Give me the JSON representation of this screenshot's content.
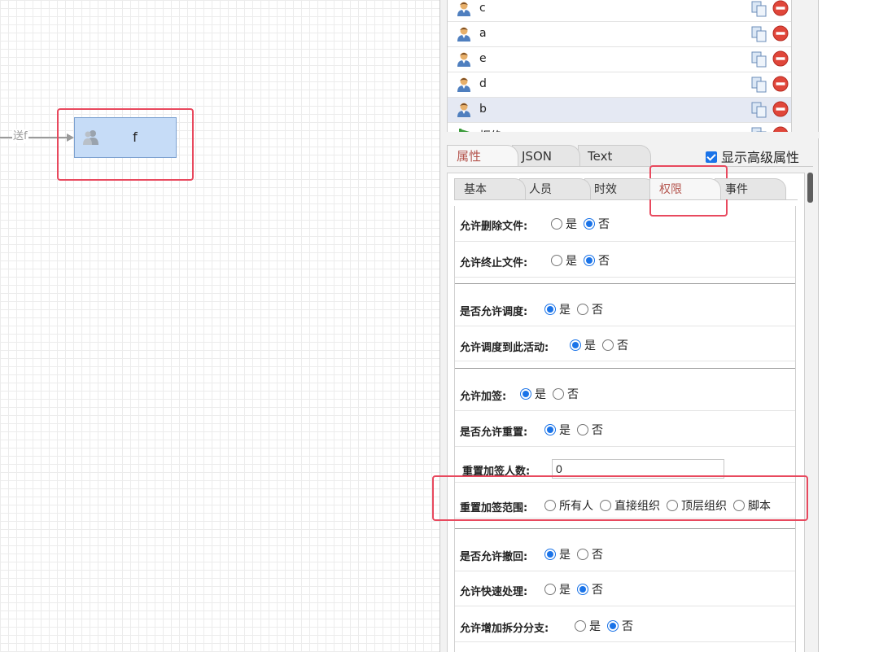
{
  "canvas": {
    "edge_label": "送f",
    "node_label": "f"
  },
  "users": [
    {
      "name": "c"
    },
    {
      "name": "a"
    },
    {
      "name": "e"
    },
    {
      "name": "d"
    },
    {
      "name": "b"
    },
    {
      "name": "拒绝"
    }
  ],
  "top_tabs": [
    "属性",
    "JSON",
    "Text"
  ],
  "show_advanced_label": "显示高级属性",
  "inner_tabs": [
    "基本",
    "人员",
    "时效",
    "权限",
    "事件"
  ],
  "form": {
    "allow_delete_file": {
      "label": "允许删除文件:",
      "options": [
        "是",
        "否"
      ],
      "selected": "否"
    },
    "allow_terminate_file": {
      "label": "允许终止文件:",
      "options": [
        "是",
        "否"
      ],
      "selected": "否"
    },
    "allow_dispatch": {
      "label": "是否允许调度:",
      "options": [
        "是",
        "否"
      ],
      "selected": "是"
    },
    "allow_dispatch_to_activity": {
      "label": "允许调度到此活动:",
      "options": [
        "是",
        "否"
      ],
      "selected": "是"
    },
    "allow_add_sign": {
      "label": "允许加签:",
      "options": [
        "是",
        "否"
      ],
      "selected": "是"
    },
    "allow_reset": {
      "label": "是否允许重置:",
      "options": [
        "是",
        "否"
      ],
      "selected": "是"
    },
    "reset_sign_count": {
      "label": "重置加签人数:",
      "value": "0"
    },
    "reset_sign_scope": {
      "label": "重置加签范围:",
      "options": [
        "所有人",
        "直接组织",
        "顶层组织",
        "脚本"
      ],
      "selected": ""
    },
    "allow_withdraw": {
      "label": "是否允许撤回:",
      "options": [
        "是",
        "否"
      ],
      "selected": "是"
    },
    "allow_quick_process": {
      "label": "允许快速处理:",
      "options": [
        "是",
        "否"
      ],
      "selected": "否"
    },
    "allow_add_branch": {
      "label": "允许增加拆分分支:",
      "options": [
        "是",
        "否"
      ],
      "selected": "否"
    }
  },
  "colors": {
    "highlight": "#e8495e",
    "radio_selected": "#1a73e8",
    "node_fill": "#c6dcf7",
    "active_tab_text": "#b5564f"
  }
}
